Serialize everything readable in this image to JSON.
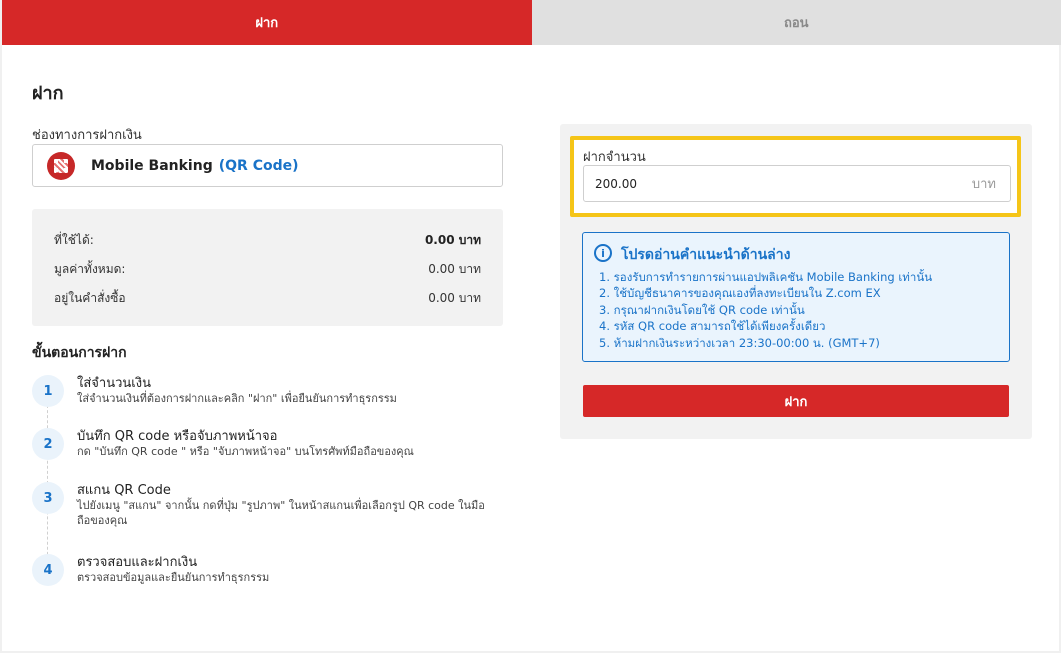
{
  "tabs": [
    {
      "label": "ฝาก",
      "active": true
    },
    {
      "label": "ถอน",
      "active": false
    }
  ],
  "page_title": "ฝาก",
  "channel": {
    "label": "ช่องทางการฝากเงิน",
    "name": "Mobile Banking",
    "sub": "(QR Code)",
    "icon": "qr-code-icon"
  },
  "balance": {
    "rows": [
      {
        "label": "ที่ใช้ได้:",
        "value": "0.00 บาท"
      },
      {
        "label": "มูลค่าทั้งหมด:",
        "value": "0.00 บาท"
      },
      {
        "label": "อยู่ในคำสั่งซื้อ",
        "value": "0.00 บาท"
      }
    ]
  },
  "steps": {
    "title": "ขั้นตอนการฝาก",
    "items": [
      {
        "num": "1",
        "title": "ใส่จำนวนเงิน",
        "desc": "ใส่จำนวนเงินที่ต้องการฝากและคลิก \"ฝาก\" เพื่อยืนยันการทำธุรกรรม"
      },
      {
        "num": "2",
        "title": "บันทึก QR code หรือจับภาพหน้าจอ",
        "desc": "กด \"บันทึก QR code \" หรือ \"จับภาพหน้าจอ\" บนโทรศัพท์มือถือของคุณ"
      },
      {
        "num": "3",
        "title": "สแกน QR Code",
        "desc": "ไปยังเมนู \"สแกน\" จากนั้น กดที่ปุ่ม \"รูปภาพ\" ในหน้าสแกนเพื่อเลือกรูป QR code ในมือถือของคุณ"
      },
      {
        "num": "4",
        "title": "ตรวจสอบและฝากเงิน",
        "desc": "ตรวจสอบข้อมูลและยืนยันการทำธุรกรรม"
      }
    ]
  },
  "deposit_form": {
    "amount_label": "ฝากจำนวน",
    "amount_value": "200.00",
    "amount_unit": "บาท",
    "highlight_color": "#f5c518",
    "info_title": "โปรดอ่านคำแนะนำด้านล่าง",
    "info_items": [
      "1. รองรับการทำรายการผ่านแอปพลิเคชัน Mobile Banking เท่านั้น",
      "2. ใช้บัญชีธนาคารของคุณเองที่ลงทะเบียนใน Z.com EX",
      "3. กรุณาฝากเงินโดยใช้ QR code เท่านั้น",
      "4. รหัส QR code สามารถใช้ได้เพียงครั้งเดียว",
      "5. ห้ามฝากเงินระหว่างเวลา 23:30-00:00 น. (GMT+7)"
    ],
    "submit_label": "ฝาก"
  },
  "colors": {
    "brand_red": "#d62828",
    "info_blue": "#1a73c8"
  }
}
